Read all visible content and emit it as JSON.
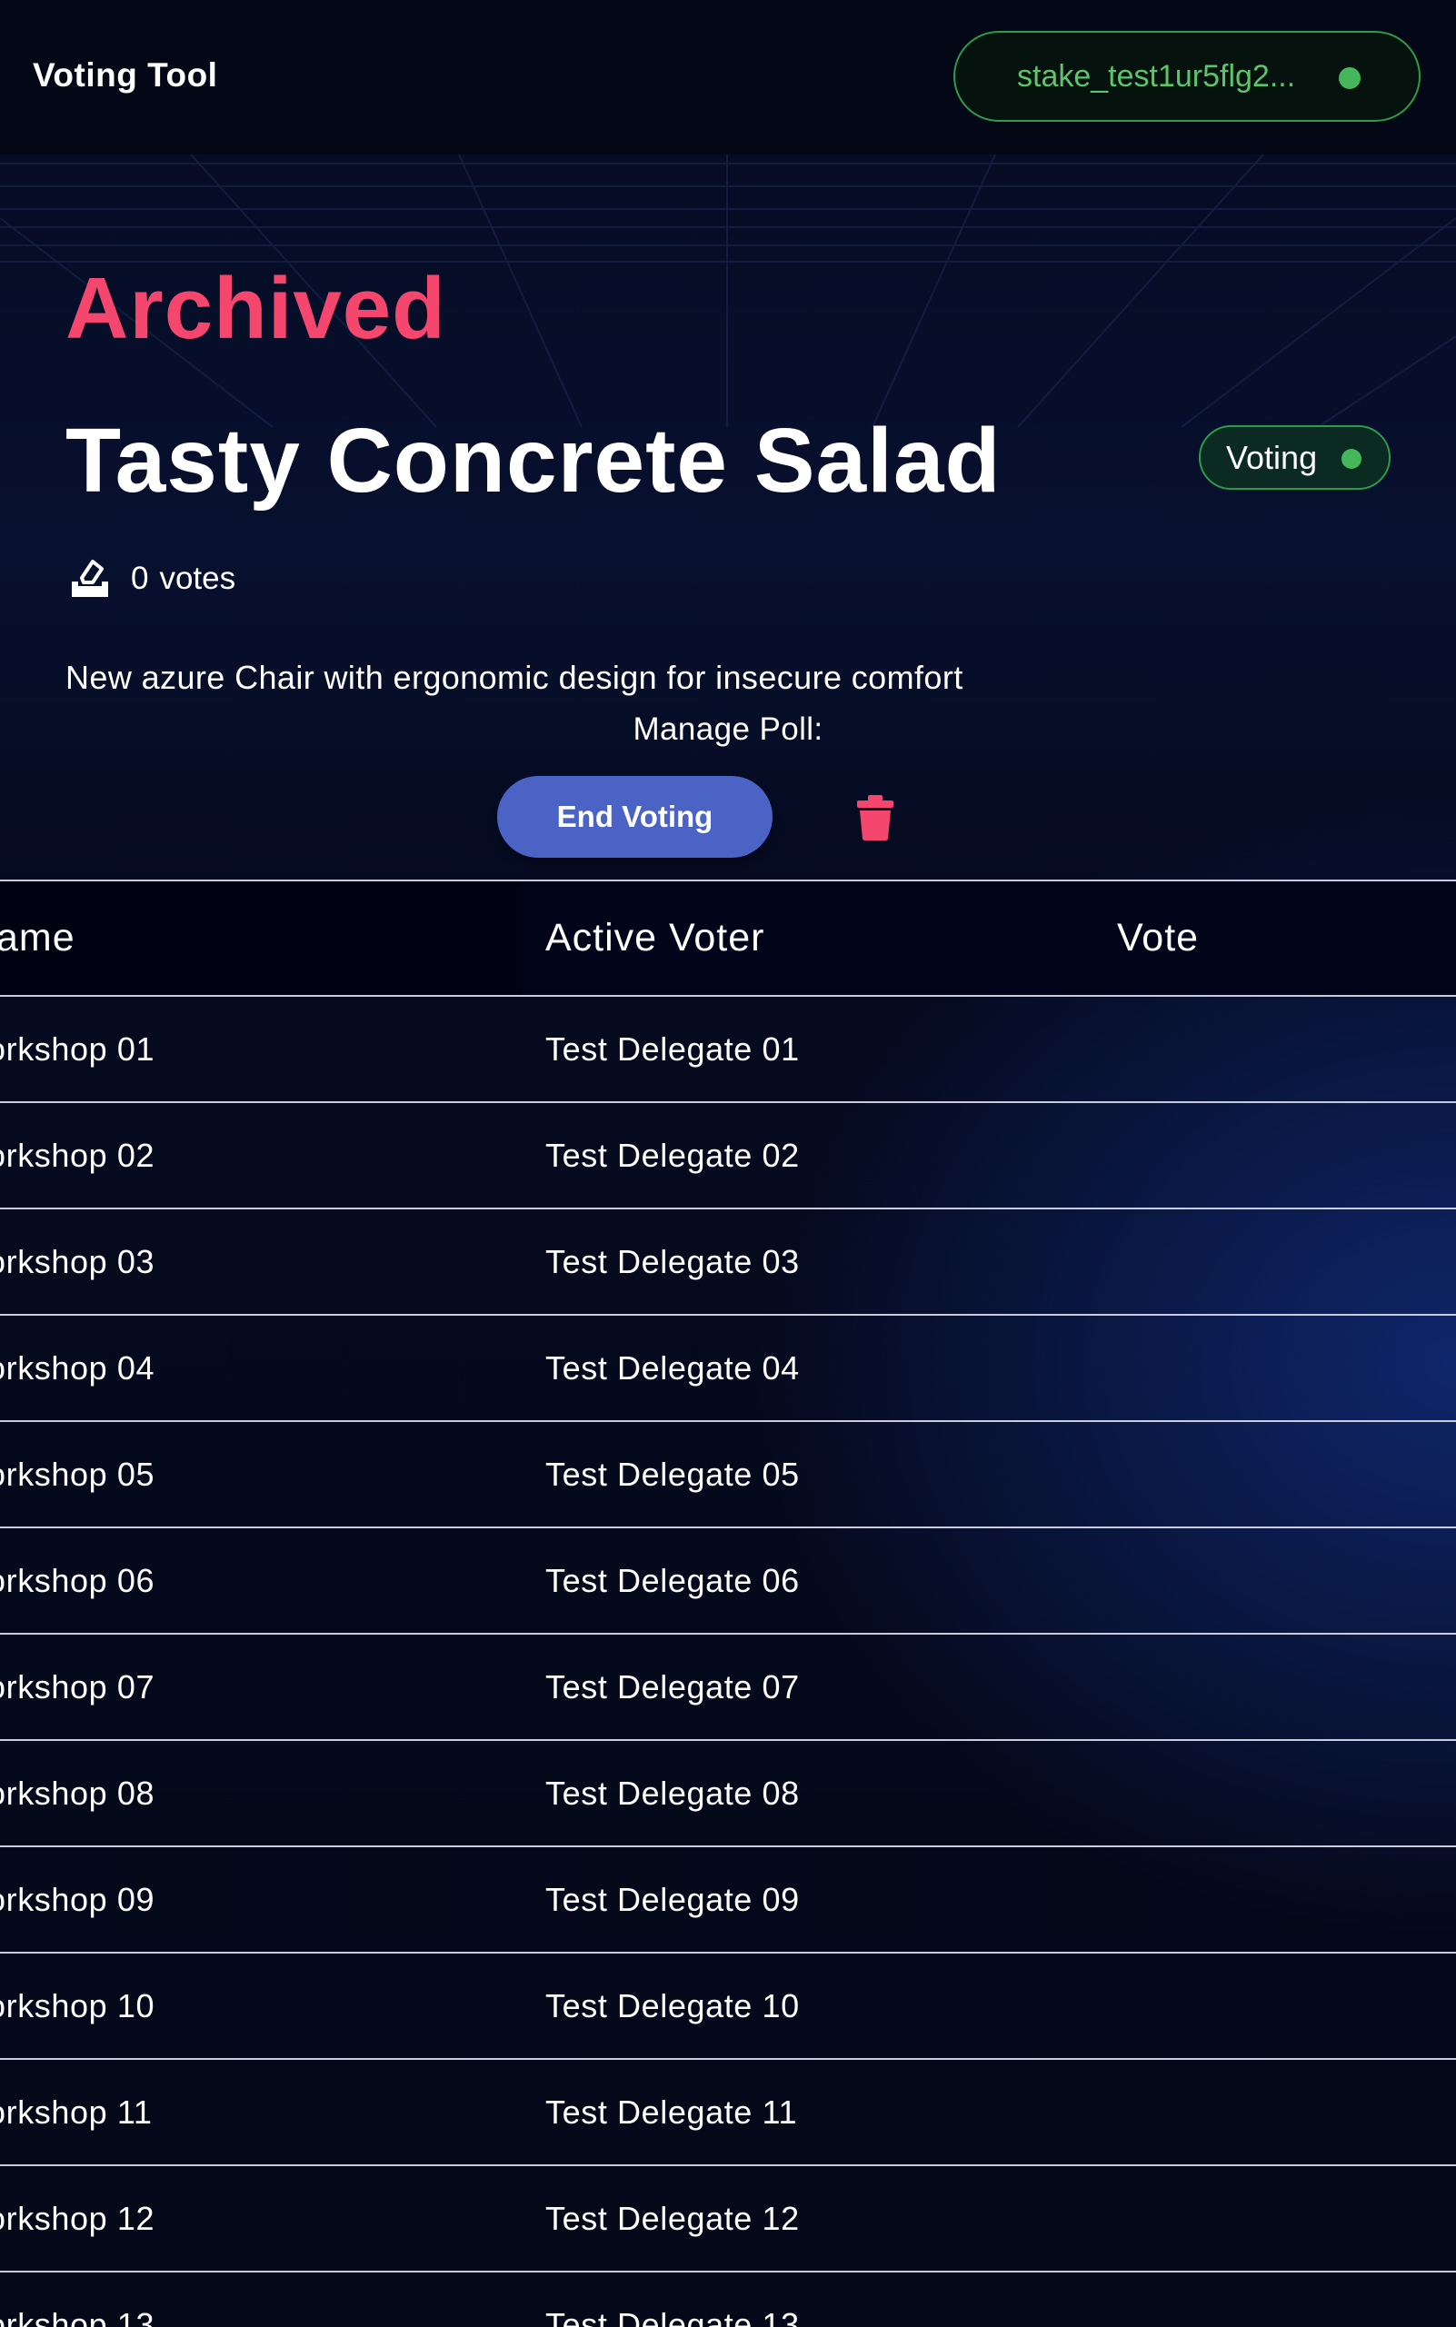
{
  "header": {
    "app_title": "Voting Tool",
    "wallet_address": "stake_test1ur5flg2...",
    "wallet_status_color": "#46b65a"
  },
  "poll": {
    "status": "Archived",
    "title": "Tasty Concrete Salad",
    "phase_badge": "Voting",
    "vote_count": "0",
    "votes_label": "votes",
    "description": "New azure Chair with ergonomic design for insecure comfort",
    "manage_label": "Manage Poll:",
    "end_voting_label": "End Voting",
    "vote_icon": "ballot-box-icon",
    "delete_icon": "trash-icon"
  },
  "colors": {
    "archived": "#f5476e",
    "primary_button": "#4b63c5",
    "badge_border": "#2f9a4a"
  },
  "table": {
    "columns": [
      "ame",
      "Active Voter",
      "Vote"
    ],
    "rows": [
      {
        "name": "orkshop 01",
        "voter": "Test Delegate 01",
        "vote": ""
      },
      {
        "name": "orkshop 02",
        "voter": "Test Delegate 02",
        "vote": ""
      },
      {
        "name": "orkshop 03",
        "voter": "Test Delegate 03",
        "vote": ""
      },
      {
        "name": "orkshop 04",
        "voter": "Test Delegate 04",
        "vote": ""
      },
      {
        "name": "orkshop 05",
        "voter": "Test Delegate 05",
        "vote": ""
      },
      {
        "name": "orkshop 06",
        "voter": "Test Delegate 06",
        "vote": ""
      },
      {
        "name": "orkshop 07",
        "voter": "Test Delegate 07",
        "vote": ""
      },
      {
        "name": "orkshop 08",
        "voter": "Test Delegate 08",
        "vote": ""
      },
      {
        "name": "orkshop 09",
        "voter": "Test Delegate 09",
        "vote": ""
      },
      {
        "name": "orkshop 10",
        "voter": "Test Delegate 10",
        "vote": ""
      },
      {
        "name": "orkshop 11",
        "voter": "Test Delegate 11",
        "vote": ""
      },
      {
        "name": "orkshop 12",
        "voter": "Test Delegate 12",
        "vote": ""
      },
      {
        "name": "orkshop 13",
        "voter": "Test Delegate 13",
        "vote": ""
      }
    ]
  }
}
